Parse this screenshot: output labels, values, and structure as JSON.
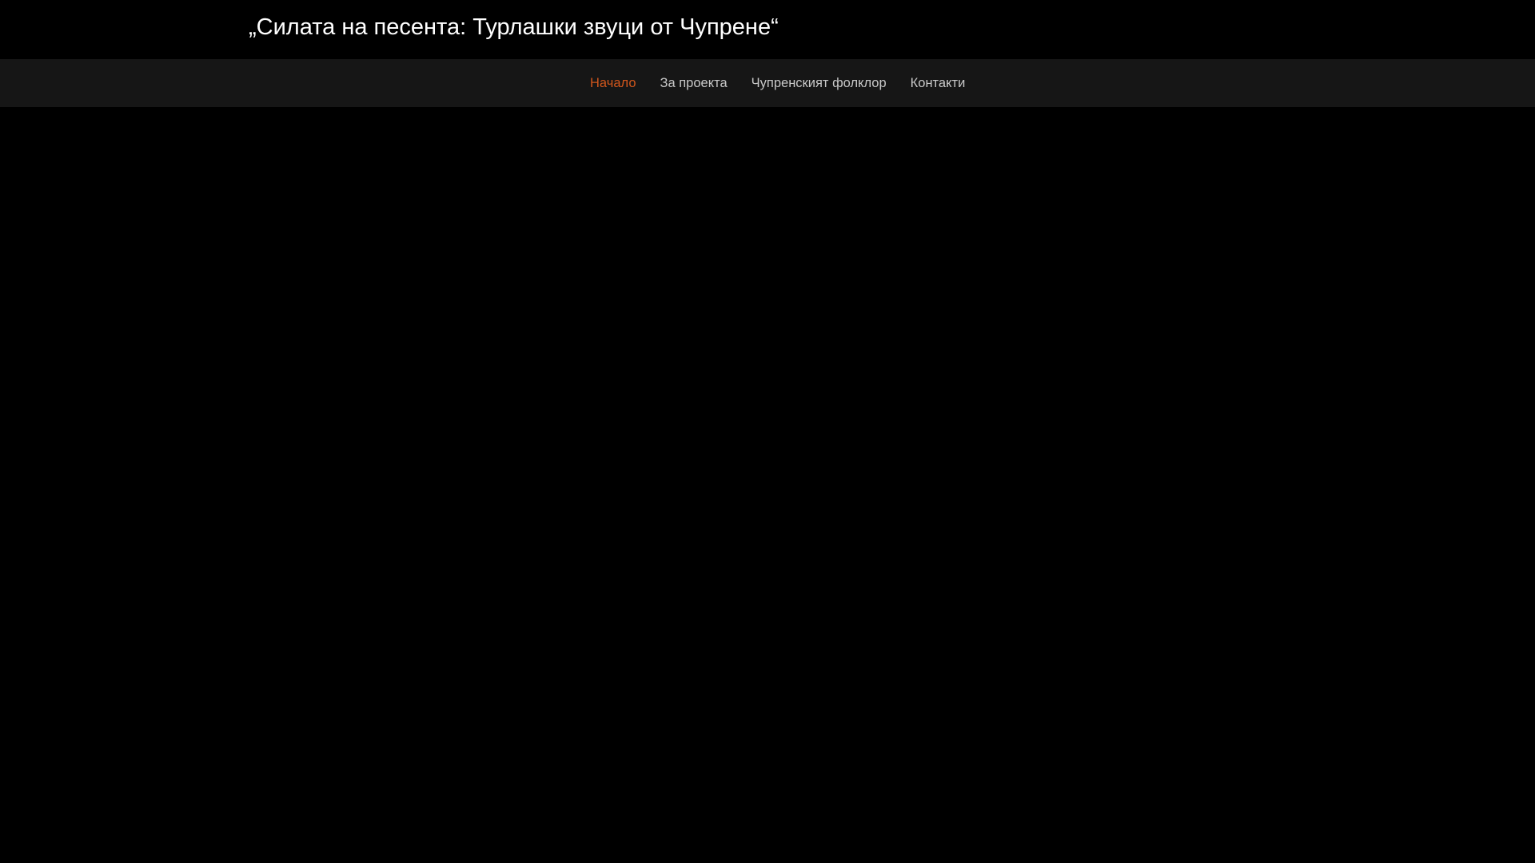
{
  "header": {
    "title": "„Силата на песента: Турлашки звуци от Чупрене“"
  },
  "nav": {
    "items": [
      {
        "label": "Начало"
      },
      {
        "label": "За проекта"
      },
      {
        "label": "Чупренският фолклор"
      },
      {
        "label": "Контакти"
      }
    ],
    "active_color": "#d0561c"
  }
}
